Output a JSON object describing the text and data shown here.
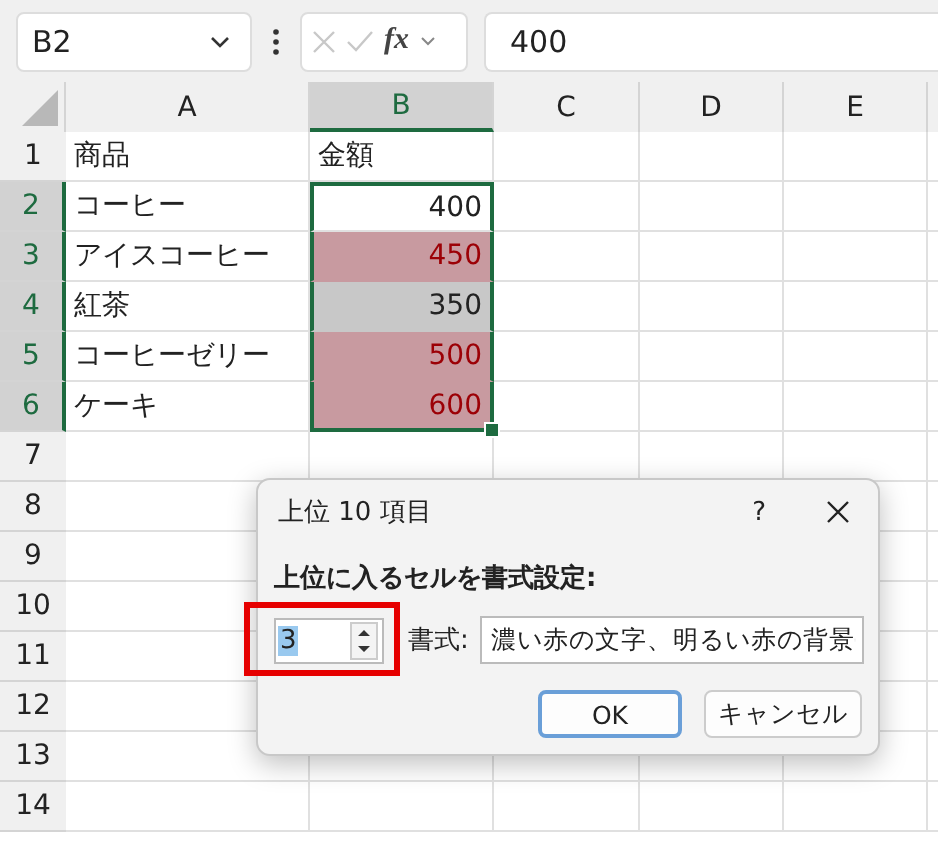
{
  "formula_bar": {
    "name_box": "B2",
    "function_label": "fx",
    "formula": "400"
  },
  "columns": [
    {
      "label": "A",
      "selected": false
    },
    {
      "label": "B",
      "selected": true
    },
    {
      "label": "C",
      "selected": false
    },
    {
      "label": "D",
      "selected": false
    },
    {
      "label": "E",
      "selected": false
    }
  ],
  "rows": [
    {
      "num": "1",
      "a": "商品",
      "b": "金額",
      "selected": false,
      "active": false,
      "highlighted": false
    },
    {
      "num": "2",
      "a": "コーヒー",
      "b": "400",
      "selected": true,
      "active": true,
      "highlighted": false
    },
    {
      "num": "3",
      "a": "アイスコーヒー",
      "b": "450",
      "selected": true,
      "active": false,
      "highlighted": true
    },
    {
      "num": "4",
      "a": "紅茶",
      "b": "350",
      "selected": true,
      "active": false,
      "highlighted": false
    },
    {
      "num": "5",
      "a": "コーヒーゼリー",
      "b": "500",
      "selected": true,
      "active": false,
      "highlighted": true
    },
    {
      "num": "6",
      "a": "ケーキ",
      "b": "600",
      "selected": true,
      "active": false,
      "highlighted": true
    },
    {
      "num": "7",
      "selected": false
    },
    {
      "num": "8",
      "selected": false
    },
    {
      "num": "9",
      "selected": false
    },
    {
      "num": "10",
      "selected": false
    },
    {
      "num": "11",
      "selected": false
    },
    {
      "num": "12",
      "selected": false
    },
    {
      "num": "13",
      "selected": false
    },
    {
      "num": "14",
      "selected": false
    }
  ],
  "dialog": {
    "title": "上位 10 項目",
    "help": "?",
    "prompt": "上位に入るセルを書式設定:",
    "count": "3",
    "format_label": "書式:",
    "format_value": "濃い赤の文字、明るい赤の背景",
    "buttons": [
      {
        "label": "OK",
        "default": true
      },
      {
        "label": "キャンセル",
        "default": false
      }
    ],
    "annotation": true
  }
}
